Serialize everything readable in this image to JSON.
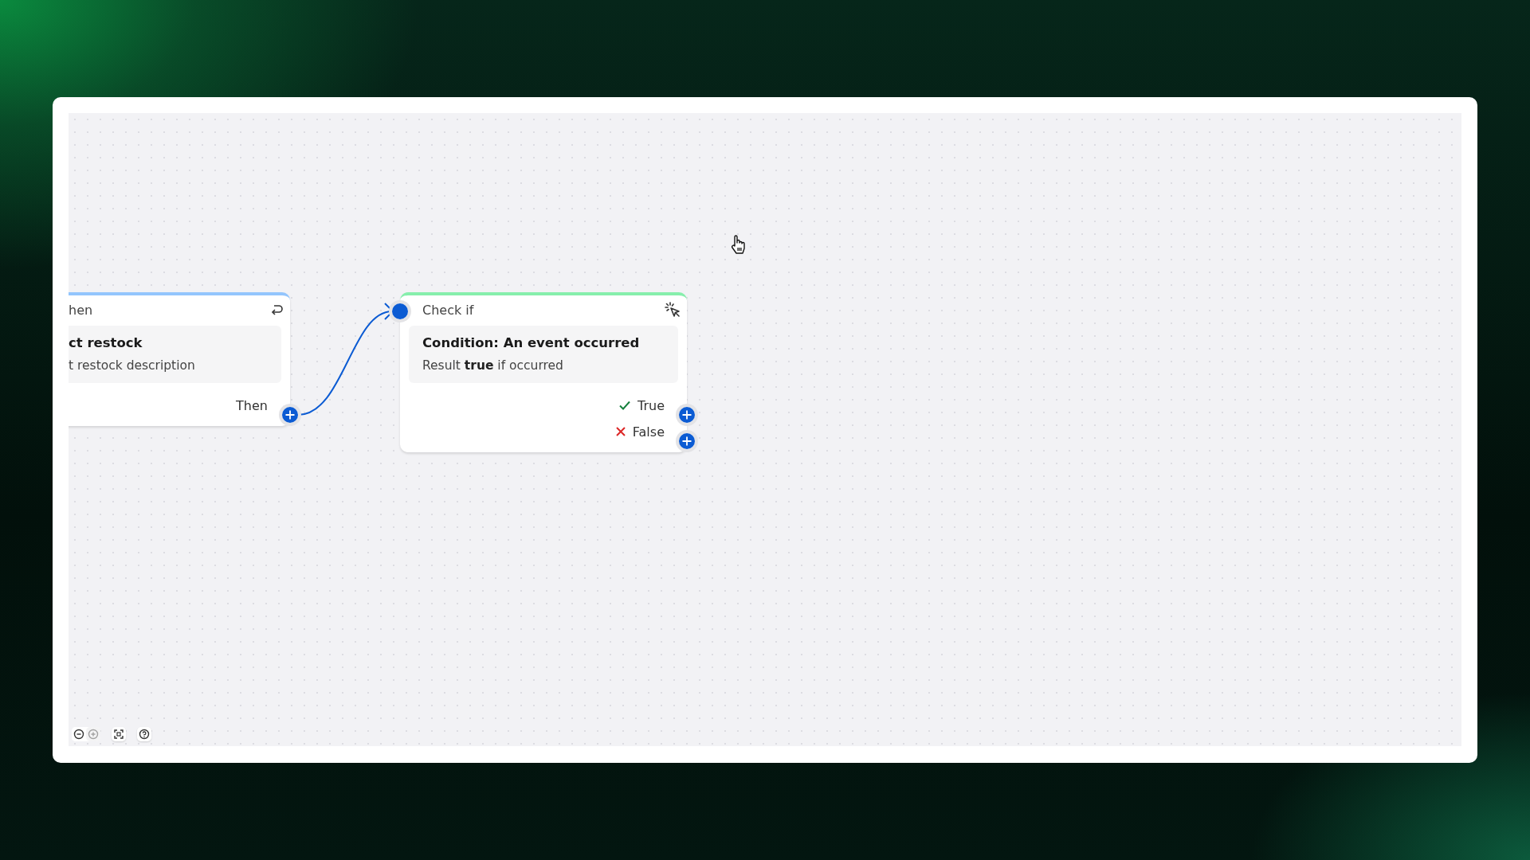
{
  "canvas": {
    "nodes": [
      {
        "kind": "trigger",
        "header": "hen",
        "title": "ct restock",
        "description": "t restock description",
        "outputs": [
          {
            "kind": "then",
            "label": "Then"
          }
        ]
      },
      {
        "kind": "condition",
        "header": "Check if",
        "title": "Condition: An event occurred",
        "description": "Result **true** if occurred",
        "input_connected": true,
        "outputs": [
          {
            "kind": "true",
            "label": "True"
          },
          {
            "kind": "false",
            "label": "False"
          }
        ]
      }
    ]
  },
  "controls": [
    {
      "kind": "zoom-out",
      "disabled": false
    },
    {
      "kind": "zoom-in",
      "disabled": true
    },
    {
      "kind": "fit"
    },
    {
      "kind": "help"
    }
  ]
}
